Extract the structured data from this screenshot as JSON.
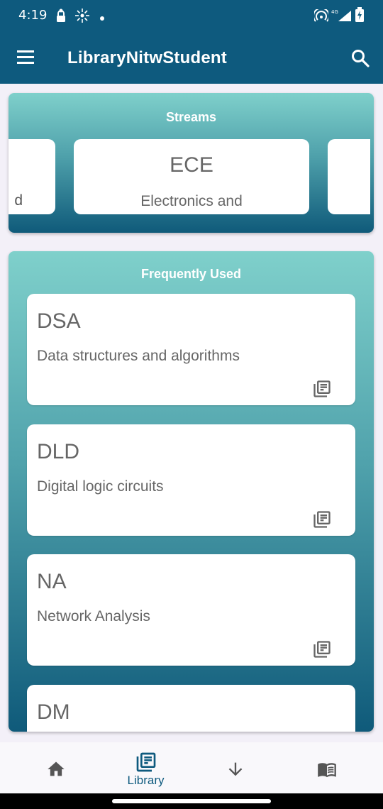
{
  "status_bar": {
    "time": "4:19",
    "icons": [
      "lock-person-icon",
      "sparkle-icon",
      "dot-icon",
      "hotspot-icon",
      "signal-4g-icon",
      "battery-icon"
    ],
    "network_label": "4G"
  },
  "app_bar": {
    "title": "LibraryNitwStudent",
    "menu_icon": "menu-icon",
    "search_icon": "search-icon"
  },
  "streams": {
    "title": "Streams",
    "cards": [
      {
        "code": "",
        "name": "d"
      },
      {
        "code": "ECE",
        "name": "Electronics and"
      },
      {
        "code": "",
        "name": ""
      }
    ]
  },
  "frequently_used": {
    "title": "Frequently Used",
    "items": [
      {
        "code": "DSA",
        "name": "Data structures and algorithms",
        "icon": "library-books-icon"
      },
      {
        "code": "DLD",
        "name": "Digital logic circuits",
        "icon": "library-books-icon"
      },
      {
        "code": "NA",
        "name": "Network Analysis",
        "icon": "library-books-icon"
      },
      {
        "code": "DM",
        "name": "",
        "icon": "library-books-icon"
      }
    ]
  },
  "bottom_nav": {
    "items": [
      {
        "icon": "home-icon",
        "label": "",
        "active": false
      },
      {
        "icon": "library-books-icon",
        "label": "Library",
        "active": true
      },
      {
        "icon": "download-arrow-icon",
        "label": "",
        "active": false
      },
      {
        "icon": "open-book-icon",
        "label": "",
        "active": false
      }
    ]
  },
  "colors": {
    "primary": "#0e5a7e",
    "gradient_top": "#7fd0cb",
    "gradient_bottom": "#0f5a7a",
    "card_text": "#666666",
    "background": "#f3f0f8"
  }
}
